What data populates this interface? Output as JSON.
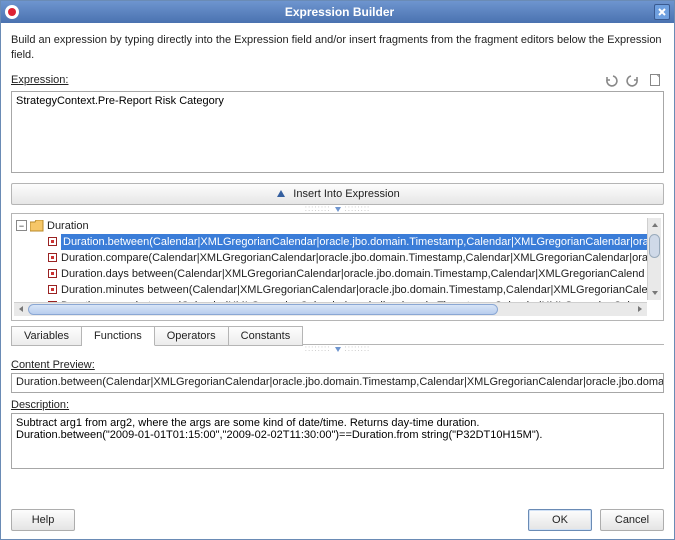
{
  "window": {
    "title": "Expression Builder"
  },
  "instructions": "Build an expression by typing directly into the Expression field and/or insert fragments from the fragment editors below the Expression field.",
  "expression": {
    "label": "Expression:",
    "value": "StrategyContext.Pre-Report Risk Category"
  },
  "toolbar": {
    "undo": "undo-icon",
    "redo": "redo-icon",
    "clear": "clear-icon"
  },
  "insert_button": "Insert Into Expression",
  "tree": {
    "root_label": "Duration",
    "items": [
      {
        "label": "Duration.between(Calendar|XMLGregorianCalendar|oracle.jbo.domain.Timestamp,Calendar|XMLGregorianCalendar|ora",
        "selected": true
      },
      {
        "label": "Duration.compare(Calendar|XMLGregorianCalendar|oracle.jbo.domain.Timestamp,Calendar|XMLGregorianCalendar|ora",
        "selected": false
      },
      {
        "label": "Duration.days between(Calendar|XMLGregorianCalendar|oracle.jbo.domain.Timestamp,Calendar|XMLGregorianCalend",
        "selected": false
      },
      {
        "label": "Duration.minutes between(Calendar|XMLGregorianCalendar|oracle.jbo.domain.Timestamp,Calendar|XMLGregorianCale",
        "selected": false
      },
      {
        "label": "Duration.years between(Calendar|XMLGregorianCalendar|oracle.jbo.domain.Timestamp,Calendar|XMLGregorianCalen",
        "selected": false
      }
    ]
  },
  "tabs": {
    "items": [
      {
        "id": "variables",
        "label": "Variables",
        "active": false
      },
      {
        "id": "functions",
        "label": "Functions",
        "active": true
      },
      {
        "id": "operators",
        "label": "Operators",
        "active": false
      },
      {
        "id": "constants",
        "label": "Constants",
        "active": false
      }
    ]
  },
  "content_preview": {
    "label": "Content Preview:",
    "value": "Duration.between(Calendar|XMLGregorianCalendar|oracle.jbo.domain.Timestamp,Calendar|XMLGregorianCalendar|oracle.jbo.domain"
  },
  "description": {
    "label": "Description:",
    "value": "Subtract arg1 from arg2, where the args are some kind of date/time. Returns day-time duration.\nDuration.between(\"2009-01-01T01:15:00\",\"2009-02-02T11:30:00\")==Duration.from string(\"P32DT10H15M\")."
  },
  "footer": {
    "help": "Help",
    "ok": "OK",
    "cancel": "Cancel"
  },
  "colors": {
    "accent": "#3b7dd8",
    "titlebar": "#4a72b0"
  }
}
